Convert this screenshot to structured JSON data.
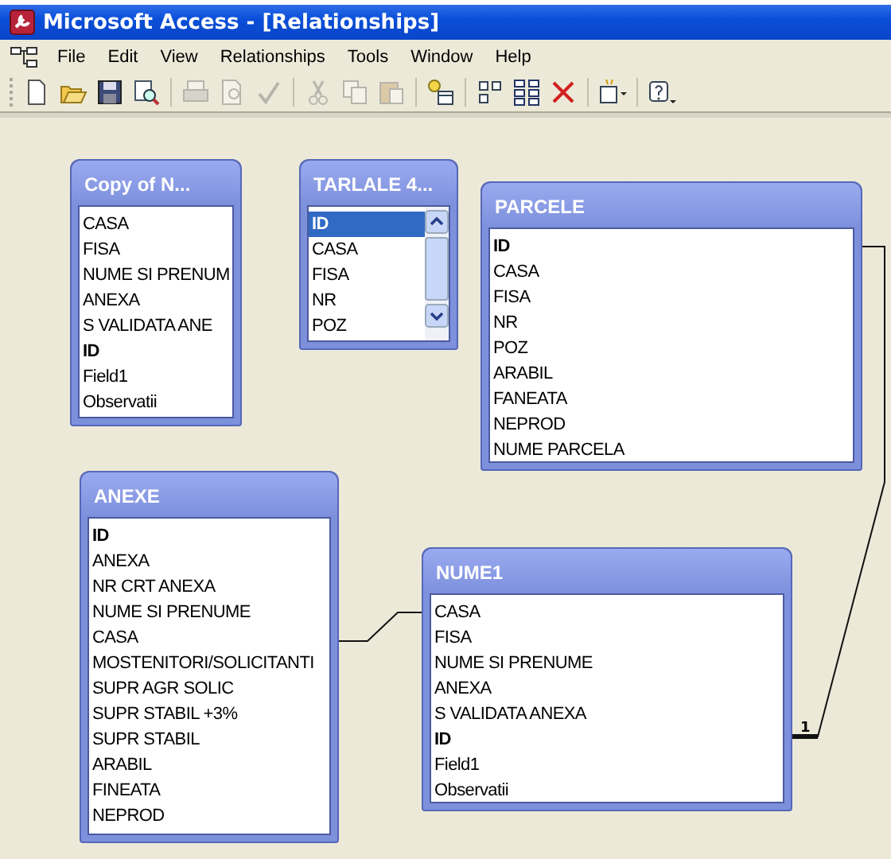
{
  "window": {
    "title": "Microsoft Access - [Relationships]"
  },
  "menu": [
    {
      "label": "File"
    },
    {
      "label": "Edit"
    },
    {
      "label": "View"
    },
    {
      "label": "Relationships"
    },
    {
      "label": "Tools"
    },
    {
      "label": "Window"
    },
    {
      "label": "Help"
    }
  ],
  "toolbar": [
    [
      {
        "kind": "new",
        "disabled": false
      },
      {
        "kind": "open",
        "disabled": false
      },
      {
        "kind": "save",
        "disabled": false
      },
      {
        "kind": "search",
        "disabled": false
      }
    ],
    [
      {
        "kind": "print",
        "disabled": true
      },
      {
        "kind": "preview",
        "disabled": true
      },
      {
        "kind": "spell",
        "disabled": true
      }
    ],
    [
      {
        "kind": "cut",
        "disabled": true
      },
      {
        "kind": "copy",
        "disabled": true
      },
      {
        "kind": "paste",
        "disabled": true
      }
    ],
    [
      {
        "kind": "show-table",
        "disabled": false
      }
    ],
    [
      {
        "kind": "direct",
        "disabled": false
      },
      {
        "kind": "all",
        "disabled": false
      },
      {
        "kind": "delete",
        "disabled": false
      }
    ],
    [
      {
        "kind": "new-object",
        "disabled": false
      }
    ],
    [
      {
        "kind": "help",
        "disabled": false
      }
    ]
  ],
  "tables": [
    {
      "title": "Copy of N...",
      "scrollbar": false,
      "fields": [
        {
          "name": "CASA",
          "key": false,
          "selected": false
        },
        {
          "name": "FISA",
          "key": false,
          "selected": false
        },
        {
          "name": "NUME SI PRENUM",
          "key": false,
          "selected": false
        },
        {
          "name": "ANEXA",
          "key": false,
          "selected": false
        },
        {
          "name": "S VALIDATA ANE",
          "key": false,
          "selected": false
        },
        {
          "name": "ID",
          "key": true,
          "selected": false
        },
        {
          "name": "Field1",
          "key": false,
          "selected": false
        },
        {
          "name": "Observatii",
          "key": false,
          "selected": false
        }
      ]
    },
    {
      "title": "TARLALE 4...",
      "scrollbar": true,
      "fields": [
        {
          "name": "ID",
          "key": true,
          "selected": true
        },
        {
          "name": "CASA",
          "key": false,
          "selected": false
        },
        {
          "name": "FISA",
          "key": false,
          "selected": false
        },
        {
          "name": "NR",
          "key": false,
          "selected": false
        },
        {
          "name": "POZ",
          "key": false,
          "selected": false
        }
      ]
    },
    {
      "title": "PARCELE",
      "scrollbar": false,
      "fields": [
        {
          "name": "ID",
          "key": true,
          "selected": false
        },
        {
          "name": "CASA",
          "key": false,
          "selected": false
        },
        {
          "name": "FISA",
          "key": false,
          "selected": false
        },
        {
          "name": "NR",
          "key": false,
          "selected": false
        },
        {
          "name": "POZ",
          "key": false,
          "selected": false
        },
        {
          "name": "ARABIL",
          "key": false,
          "selected": false
        },
        {
          "name": "FANEATA",
          "key": false,
          "selected": false
        },
        {
          "name": "NEPROD",
          "key": false,
          "selected": false
        },
        {
          "name": "NUME PARCELA",
          "key": false,
          "selected": false
        }
      ]
    },
    {
      "title": "ANEXE",
      "scrollbar": false,
      "fields": [
        {
          "name": "ID",
          "key": true,
          "selected": false
        },
        {
          "name": "ANEXA",
          "key": false,
          "selected": false
        },
        {
          "name": "NR CRT ANEXA",
          "key": false,
          "selected": false
        },
        {
          "name": "NUME SI PRENUME",
          "key": false,
          "selected": false
        },
        {
          "name": "CASA",
          "key": false,
          "selected": false
        },
        {
          "name": "MOSTENITORI/SOLICITANTI",
          "key": false,
          "selected": false
        },
        {
          "name": "SUPR AGR SOLIC",
          "key": false,
          "selected": false
        },
        {
          "name": "SUPR STABIL +3%",
          "key": false,
          "selected": false
        },
        {
          "name": "SUPR STABIL",
          "key": false,
          "selected": false
        },
        {
          "name": "ARABIL",
          "key": false,
          "selected": false
        },
        {
          "name": "FINEATA",
          "key": false,
          "selected": false
        },
        {
          "name": "NEPROD",
          "key": false,
          "selected": false
        }
      ]
    },
    {
      "title": "NUME1",
      "scrollbar": false,
      "fields": [
        {
          "name": "CASA",
          "key": false,
          "selected": false
        },
        {
          "name": "FISA",
          "key": false,
          "selected": false
        },
        {
          "name": "NUME SI PRENUME",
          "key": false,
          "selected": false
        },
        {
          "name": "ANEXA",
          "key": false,
          "selected": false
        },
        {
          "name": "S VALIDATA ANEXA",
          "key": false,
          "selected": false
        },
        {
          "name": "ID",
          "key": true,
          "selected": false
        },
        {
          "name": "Field1",
          "key": false,
          "selected": false
        },
        {
          "name": "Observatii",
          "key": false,
          "selected": false
        }
      ]
    }
  ],
  "relationships": [
    {
      "enforced": false
    },
    {
      "enforced": true,
      "label": "1"
    }
  ]
}
